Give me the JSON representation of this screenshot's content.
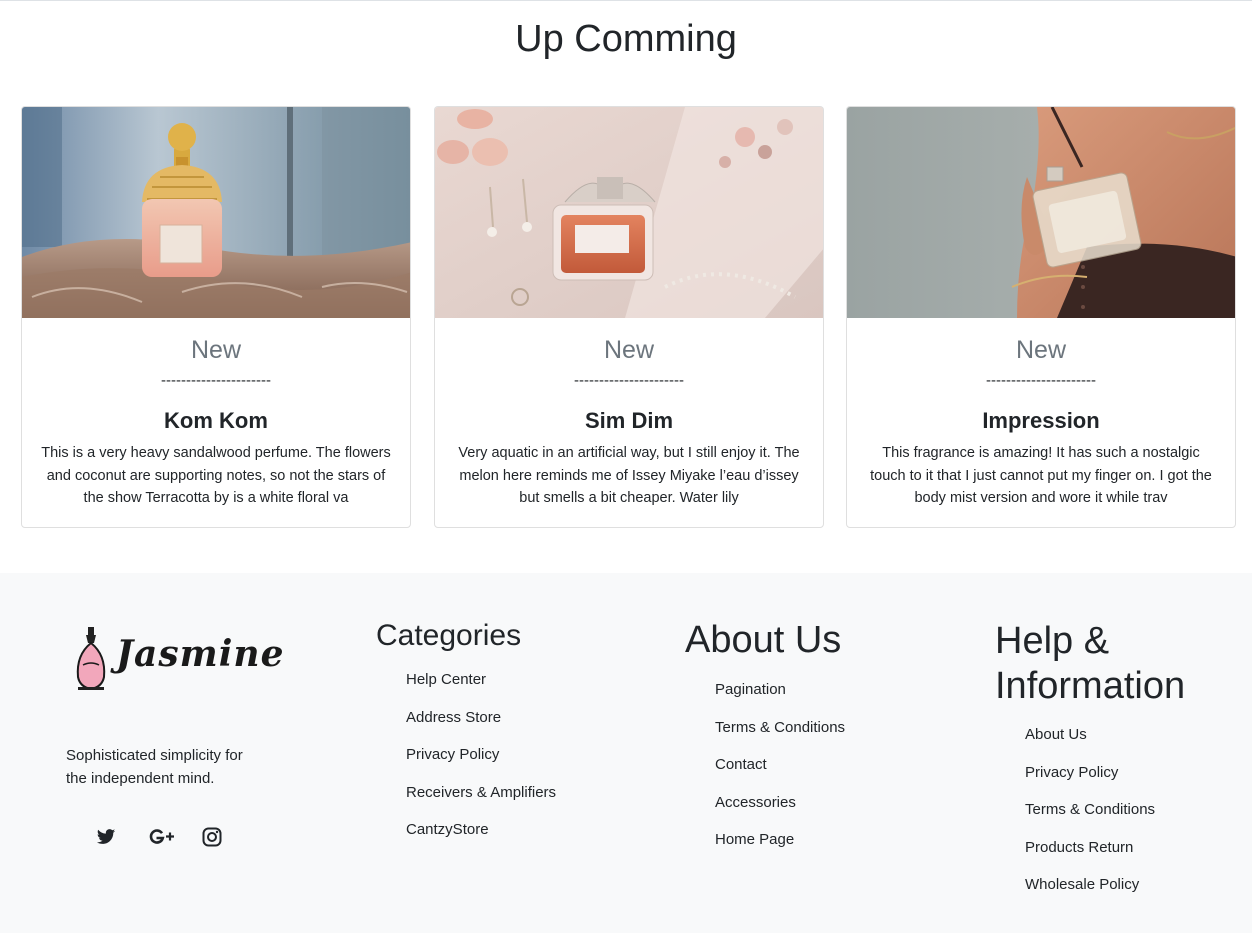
{
  "section": {
    "title": "Up Comming"
  },
  "cards": [
    {
      "badge": "New",
      "divider": "----------------------",
      "name": "Kom Kom",
      "text": "This is a very heavy sandalwood perfume. The flowers and coconut are supporting notes, so not the stars of the show Terracotta by is a white floral va"
    },
    {
      "badge": "New",
      "divider": "----------------------",
      "name": "Sim Dim",
      "text": "Very aquatic in an artificial way, but I still enjoy it. The melon here reminds me of Issey Miyake l’eau d’issey but smells a bit cheaper. Water lily"
    },
    {
      "badge": "New",
      "divider": "----------------------",
      "name": "Impression",
      "text": "This fragrance is amazing! It has such a nostalgic touch to it that I just cannot put my finger on. I got the body mist version and wore it while trav"
    }
  ],
  "footer": {
    "logo_text": "Jasmine",
    "tagline": "Sophisticated simplicity for the independent mind.",
    "social_icons": [
      "twitter-icon",
      "google-plus-icon",
      "instagram-icon"
    ],
    "categories": {
      "title": "Categories",
      "links": [
        "Help Center",
        "Address Store",
        "Privacy Policy",
        "Receivers & Amplifiers",
        "CantzyStore"
      ]
    },
    "about": {
      "title": "About Us",
      "links": [
        "Pagination",
        "Terms & Conditions",
        "Contact",
        "Accessories",
        "Home Page"
      ]
    },
    "help": {
      "title": "Help & Information",
      "links": [
        "About Us",
        "Privacy Policy",
        "Terms & Conditions",
        "Products Return",
        "Wholesale Policy"
      ]
    }
  }
}
